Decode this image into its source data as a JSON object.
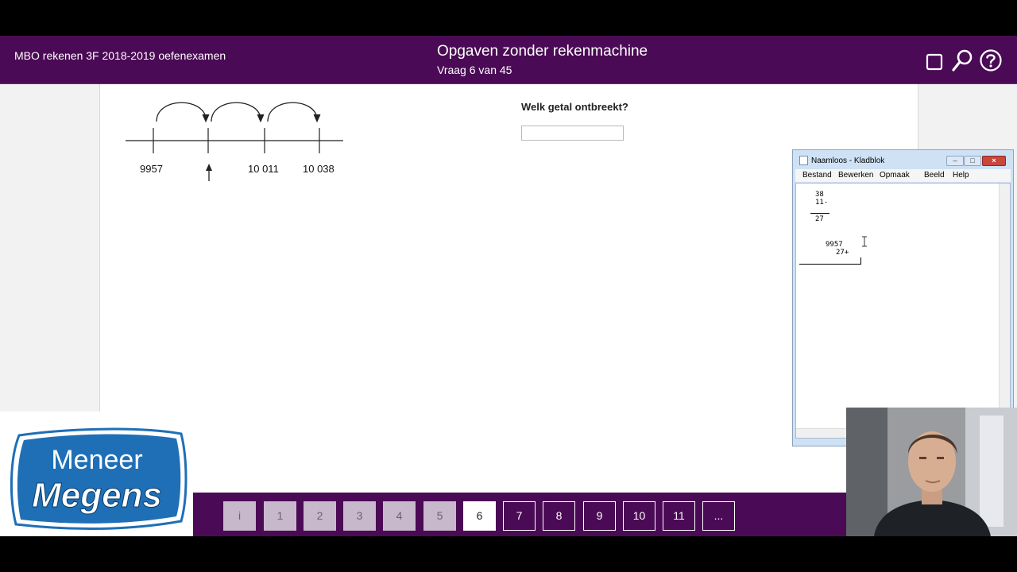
{
  "header": {
    "exam_title": "MBO rekenen 3F 2018-2019 oefenexamen",
    "section_title": "Opgaven zonder rekenmachine",
    "question_counter": "Vraag 6 van 45",
    "icons": [
      "square-icon",
      "search-icon",
      "help-icon"
    ]
  },
  "question": {
    "numberline_labels": [
      "9957",
      "10 011",
      "10 038"
    ],
    "prompt": "Welk getal ontbreekt?",
    "answer_value": ""
  },
  "notepad": {
    "title": "Naamloos - Kladblok",
    "menu": [
      "Bestand",
      "Bewerken",
      "Opmaak",
      "Beeld",
      "Help"
    ],
    "calc1": {
      "top": "38",
      "sub": "11-",
      "result": "27"
    },
    "calc2": {
      "top": "9957",
      "add": "27+"
    }
  },
  "logo": {
    "line1": "Meneer",
    "line2": "Megens"
  },
  "pagination": {
    "pages": [
      "i",
      "1",
      "2",
      "3",
      "4",
      "5",
      "6",
      "7",
      "8",
      "9",
      "10",
      "11",
      "..."
    ],
    "current": "6"
  },
  "colors": {
    "header_purple": "#4b0a55",
    "logo_blue": "#1f6fb7"
  }
}
